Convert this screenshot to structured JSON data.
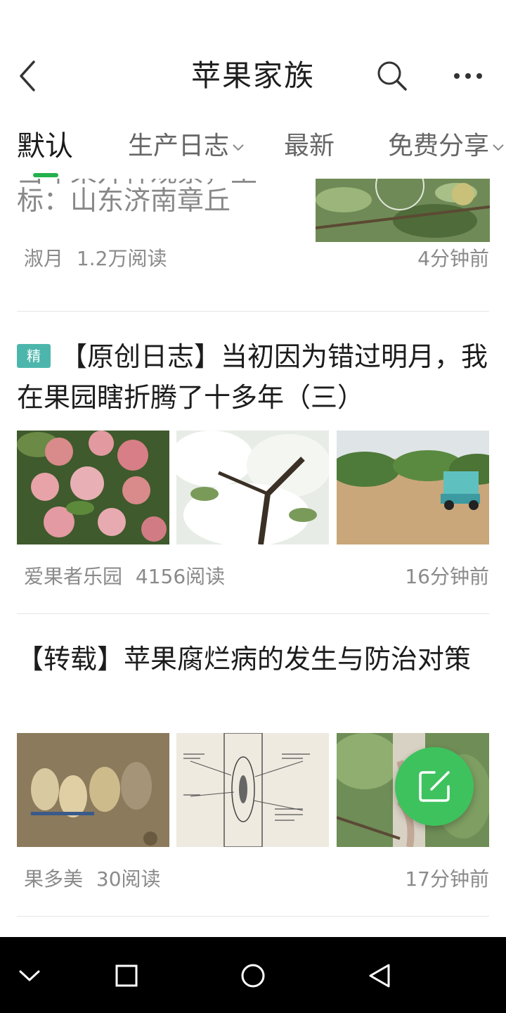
{
  "header": {
    "title": "苹果家族"
  },
  "tabs": [
    {
      "label": "默认",
      "active": true,
      "has_dropdown": false
    },
    {
      "label": "生产日志",
      "active": false,
      "has_dropdown": true
    },
    {
      "label": "最新",
      "active": false,
      "has_dropdown": false
    },
    {
      "label": "免费分享",
      "active": false,
      "has_dropdown": true
    }
  ],
  "posts": [
    {
      "title_partial_top": "当年果开种观察，坐",
      "title_line": "标：山东济南章丘",
      "author": "淑月",
      "reads": "1.2万阅读",
      "time": "4分钟前"
    },
    {
      "badge": "精",
      "title": "【原创日志】当初因为错过明月，我在果园瞎折腾了十多年（三）",
      "author": "爱果者乐园",
      "reads": "4156阅读",
      "time": "16分钟前"
    },
    {
      "title": "【转载】苹果腐烂病的发生与防治对策",
      "author": "果多美",
      "reads": "30阅读",
      "time": "17分钟前"
    }
  ],
  "icons": {
    "back": "chevron-left-icon",
    "search": "search-icon",
    "more": "more-dots-icon",
    "fab": "compose-icon",
    "nav": [
      "chevron-down-icon",
      "square-icon",
      "circle-icon",
      "triangle-back-icon"
    ]
  },
  "colors": {
    "accent": "#22b14c",
    "fab": "#3ec25e",
    "badge": "#4db6ac",
    "meta_text": "#8a8a8a"
  }
}
